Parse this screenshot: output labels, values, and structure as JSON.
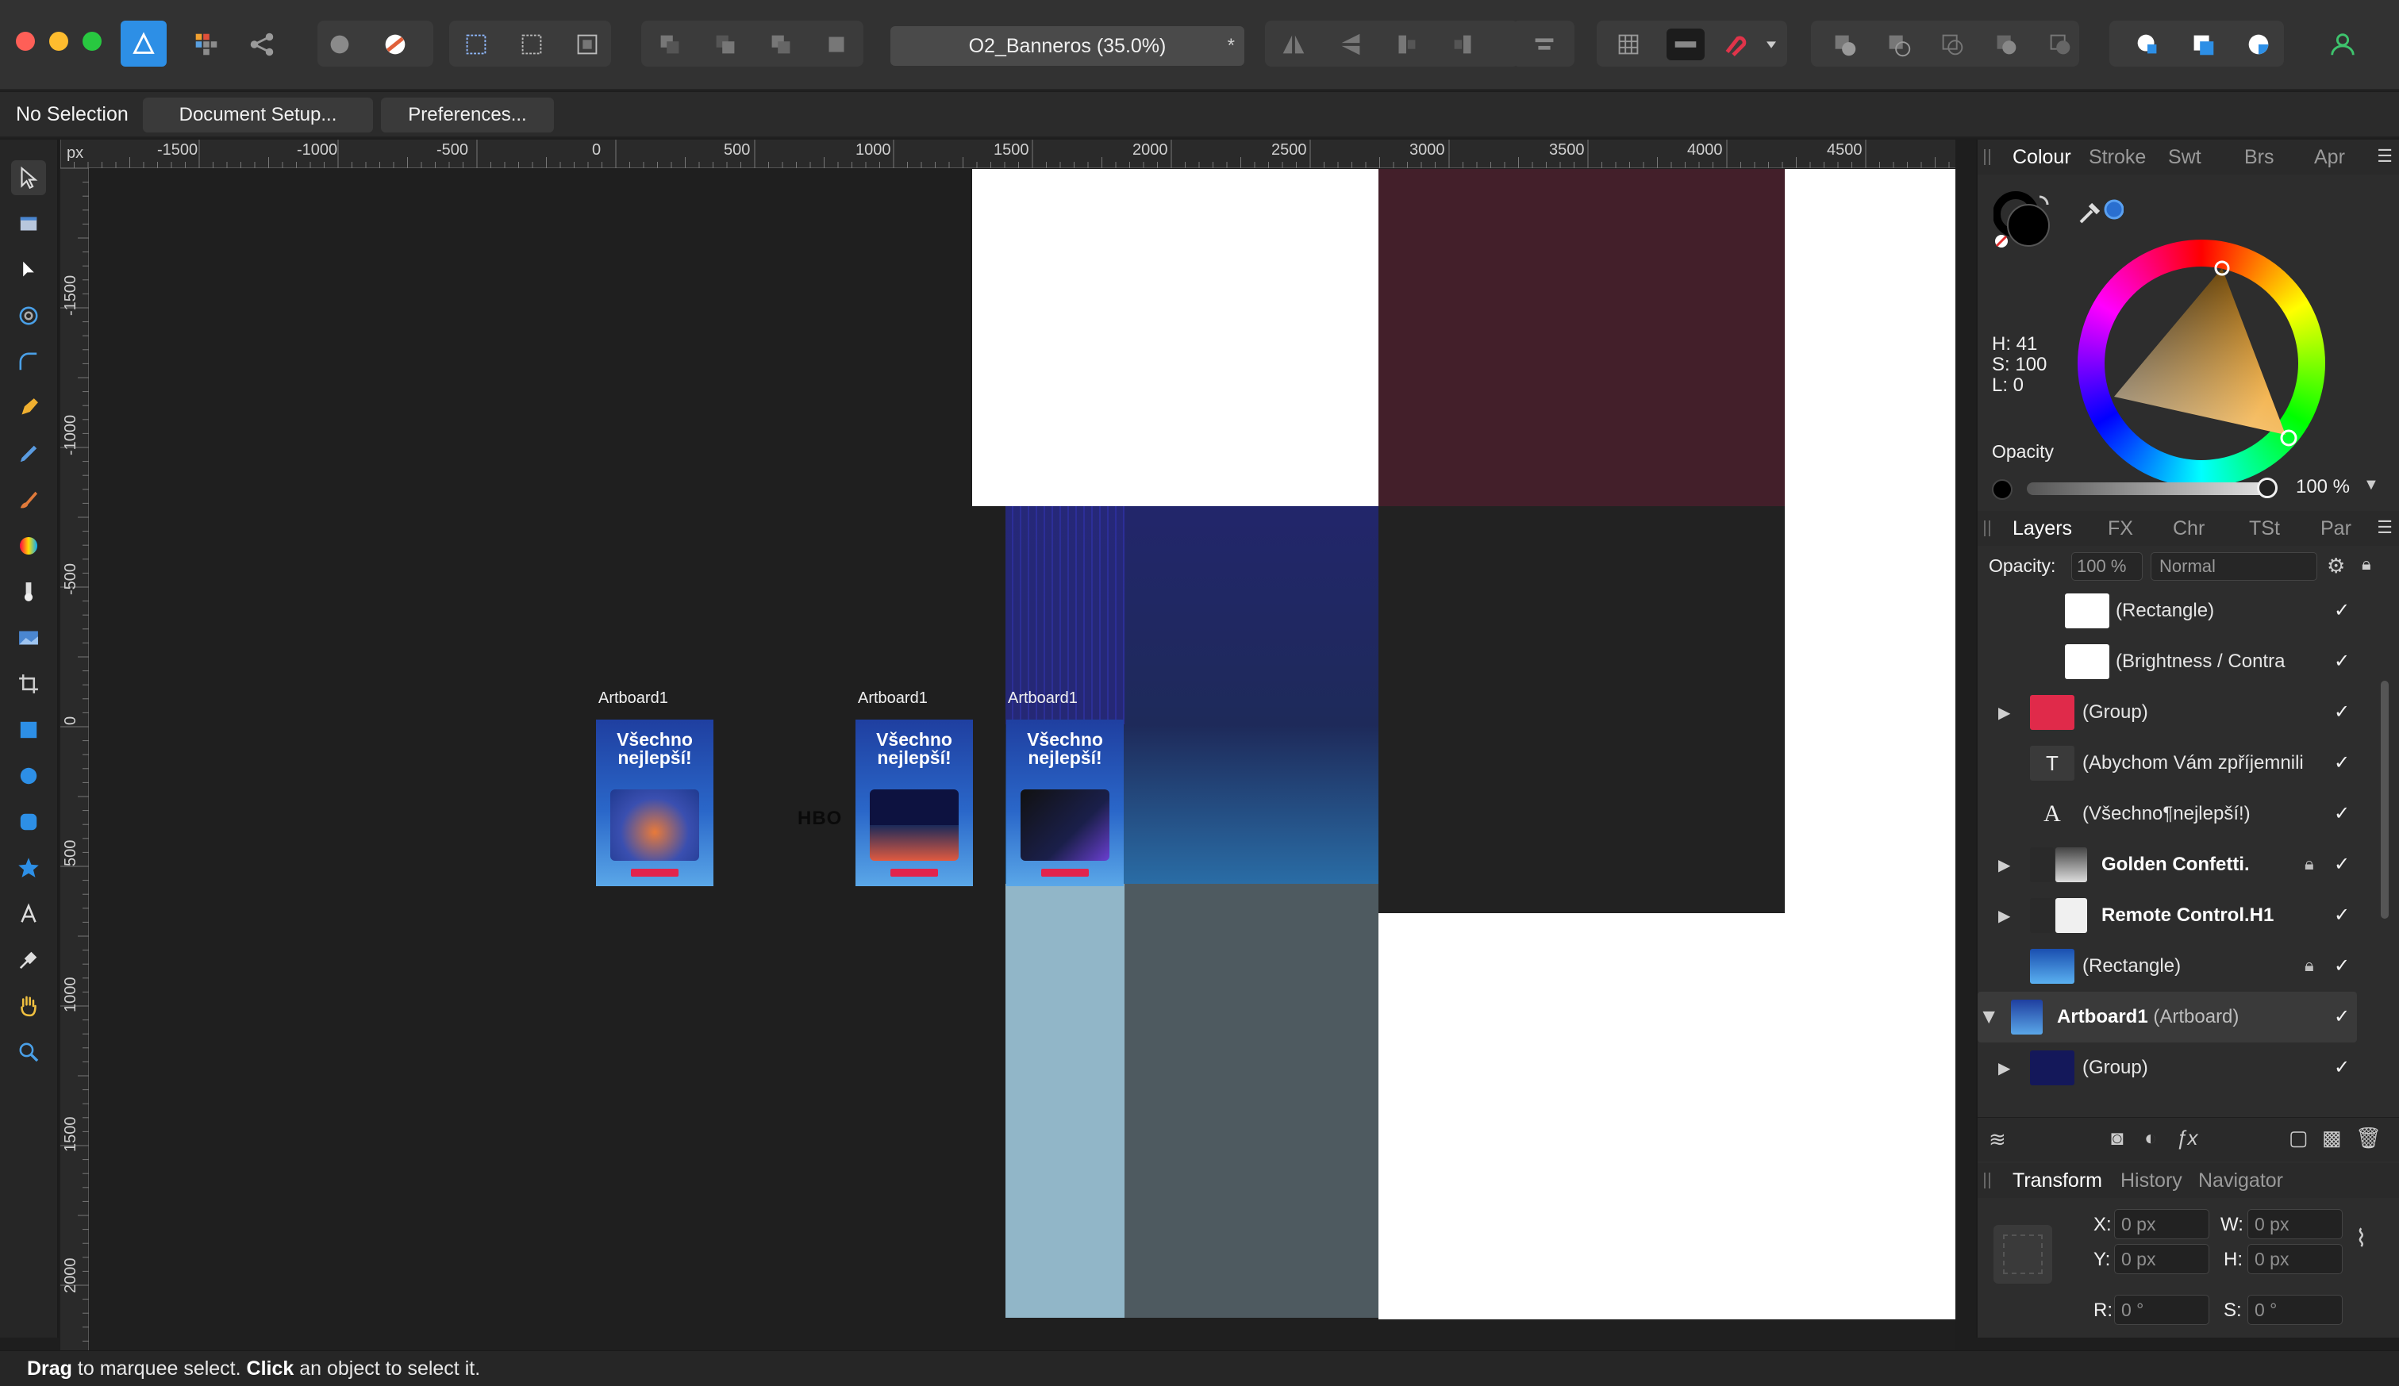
{
  "app": {
    "brand_color": "#2d8fe6"
  },
  "document": {
    "title": "O2_Banneros (35.0%)",
    "modified_mark": "*"
  },
  "context_bar": {
    "selection": "No Selection",
    "document_setup": "Document Setup...",
    "preferences": "Preferences..."
  },
  "ruler": {
    "unit": "px",
    "horizontal": [
      "-1500",
      "-1000",
      "-500",
      "0",
      "500",
      "1000",
      "1500",
      "2000",
      "2500",
      "3000",
      "3500",
      "4000",
      "4500"
    ],
    "vertical": [
      "-1500",
      "-1000",
      "-500",
      "0",
      "500",
      "1000",
      "1500",
      "2000"
    ]
  },
  "canvas": {
    "artboards": [
      {
        "label": "Artboard1",
        "headline": "Všechno\nnejlepší!"
      },
      {
        "label": "Artboard1",
        "headline": "Všechno\nnejlepší!"
      },
      {
        "label": "Artboard1",
        "headline": "Všechno\nnejlepší!"
      }
    ],
    "logo_text": "HBO",
    "colors": {
      "maroon": "#431f2a",
      "navy": "#22266b",
      "slate": "#4e5a60",
      "light_blue": "#91b6c8"
    }
  },
  "colour_panel": {
    "tabs": [
      "Colour",
      "Stroke",
      "Swt",
      "Brs",
      "Apr"
    ],
    "active_tab": "Colour",
    "h": "H: 41",
    "s": "S: 100",
    "l": "L: 0",
    "opacity_label": "Opacity",
    "opacity_value": "100 %",
    "opacity_fraction": 1.0
  },
  "layers_panel": {
    "tabs": [
      "Layers",
      "FX",
      "Chr",
      "TSt",
      "Par"
    ],
    "active_tab": "Layers",
    "opacity_label": "Opacity:",
    "opacity_value": "100 %",
    "blend_mode": "Normal",
    "rows": [
      {
        "name": "(Rectangle)",
        "expandable": false,
        "bold": false,
        "locked": false,
        "visible": "✓"
      },
      {
        "name": "(Brightness / Contra",
        "expandable": false,
        "bold": false,
        "locked": false,
        "visible": "✓"
      },
      {
        "name": "(Group)",
        "expandable": true,
        "bold": false,
        "locked": false,
        "visible": "✓"
      },
      {
        "name": "(Abychom Vám zpříjemnili",
        "expandable": false,
        "bold": false,
        "locked": false,
        "visible": "✓"
      },
      {
        "name": "(Všechno¶nejlepší!)",
        "expandable": false,
        "bold": false,
        "locked": false,
        "visible": "✓"
      },
      {
        "name": "Golden Confetti.",
        "expandable": true,
        "bold": true,
        "locked": true,
        "visible": "✓"
      },
      {
        "name": "Remote Control.H1",
        "expandable": true,
        "bold": true,
        "locked": false,
        "visible": "✓"
      },
      {
        "name": "(Rectangle)",
        "expandable": false,
        "bold": false,
        "locked": true,
        "visible": "✓"
      },
      {
        "name": "Artboard1",
        "suffix": "(Artboard)",
        "expandable": true,
        "expanded": true,
        "bold": true,
        "locked": false,
        "visible": "✓"
      },
      {
        "name": "(Group)",
        "expandable": true,
        "bold": false,
        "locked": false,
        "visible": "✓"
      }
    ]
  },
  "transform_panel": {
    "tabs": [
      "Transform",
      "History",
      "Navigator"
    ],
    "active_tab": "Transform",
    "x_label": "X:",
    "x_value": "0 px",
    "y_label": "Y:",
    "y_value": "0 px",
    "w_label": "W:",
    "w_value": "0 px",
    "h_label": "H:",
    "h_value": "0 px",
    "r_label": "R:",
    "r_value": "0 °",
    "s_label": "S:",
    "s_value": "0 °"
  },
  "status_bar": {
    "drag_word": "Drag",
    "drag_text": " to marquee select. ",
    "click_word": "Click",
    "click_text": " an object to select it."
  }
}
